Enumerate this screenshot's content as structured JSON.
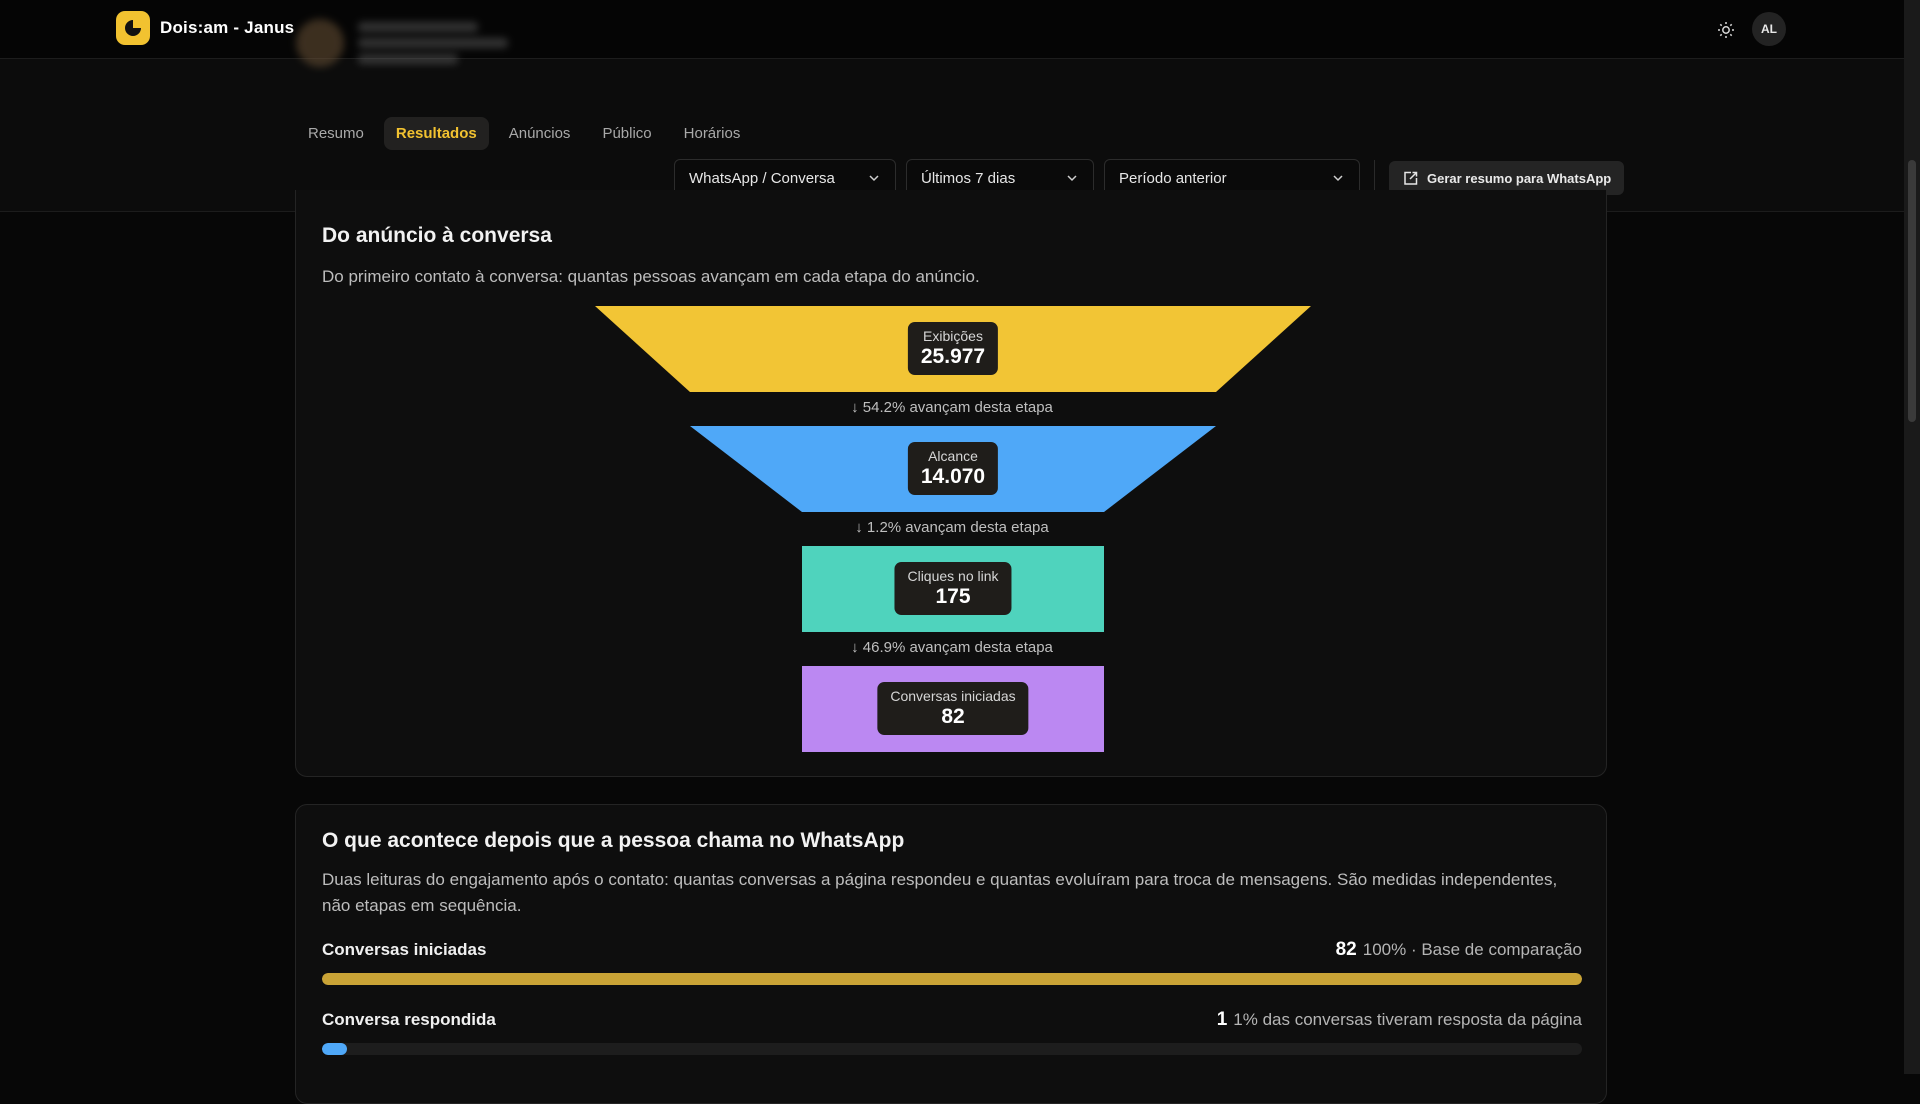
{
  "app": {
    "name": "Dois:am - Janus",
    "user_initials": "AL"
  },
  "tabs": [
    {
      "label": "Resumo",
      "active": false
    },
    {
      "label": "Resultados",
      "active": true
    },
    {
      "label": "Anúncios",
      "active": false
    },
    {
      "label": "Público",
      "active": false
    },
    {
      "label": "Horários",
      "active": false
    }
  ],
  "filters": {
    "objective": "WhatsApp / Conversa",
    "period": "Últimos 7 dias",
    "comparison": "Período anterior",
    "generate_button": "Gerar resumo para WhatsApp"
  },
  "funnel_card": {
    "title": "Do anúncio à conversa",
    "subtitle": "Do primeiro contato à conversa: quantas pessoas avançam em cada etapa do anúncio.",
    "stages": [
      {
        "name": "Exibições",
        "value": "25.977",
        "color": "#f2c535"
      },
      {
        "name": "Alcance",
        "value": "14.070",
        "color": "#4fa8f8"
      },
      {
        "name": "Cliques no link",
        "value": "175",
        "color": "#4fd3bd"
      },
      {
        "name": "Conversas iniciadas",
        "value": "82",
        "color": "#bb88f2"
      }
    ],
    "rates": [
      "↓ 54.2% avançam desta etapa",
      "↓ 1.2% avançam desta etapa",
      "↓ 46.9% avançam desta etapa"
    ]
  },
  "whatsapp_card": {
    "title": "O que acontece depois que a pessoa chama no WhatsApp",
    "subtitle_line1": "Duas leituras do engajamento após o contato: quantas conversas a página respondeu e quantas evoluíram para troca de mensagens. São medidas independentes,",
    "subtitle_line2": "não etapas em sequência.",
    "bars": [
      {
        "label": "Conversas iniciadas",
        "value": "82",
        "note": "100% · Base de comparação",
        "fraction": 1.0,
        "color": "#c9a336"
      },
      {
        "label": "Conversa respondida",
        "value": "1",
        "note": "1% das conversas tiveram resposta da página",
        "fraction": 0.02,
        "color": "#4fa8f8"
      }
    ]
  },
  "colors": {
    "accent": "#f2c230",
    "background": "#070707",
    "card": "#0e0e0e"
  }
}
